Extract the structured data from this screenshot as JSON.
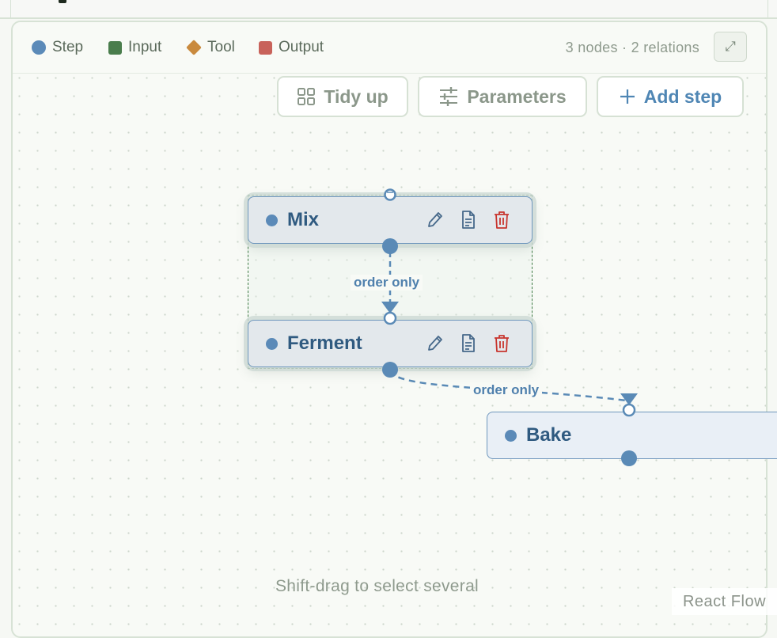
{
  "legend": {
    "items": [
      {
        "label": "Step",
        "color": "#5b8ab8",
        "shape": "circle"
      },
      {
        "label": "Input",
        "color": "#4a7d4c",
        "shape": "square"
      },
      {
        "label": "Tool",
        "color": "#c98a3e",
        "shape": "diamond"
      },
      {
        "label": "Output",
        "color": "#c8625a",
        "shape": "square"
      }
    ],
    "counts": "3 nodes · 2 relations",
    "expand_icon": "expand-icon"
  },
  "toolbar": {
    "tidy_label": "Tidy up",
    "parameters_label": "Parameters",
    "add_step_label": "Add step"
  },
  "nodes": {
    "mix": {
      "label": "Mix"
    },
    "ferment": {
      "label": "Ferment"
    },
    "bake": {
      "label": "Bake"
    }
  },
  "edges": [
    {
      "from": "Mix",
      "to": "Ferment",
      "label": "order only"
    },
    {
      "from": "Ferment",
      "to": "Bake",
      "label": "order only"
    }
  ],
  "hint": "Shift-drag to select several",
  "attribution": "React Flow",
  "colors": {
    "step": "#5b8ab8",
    "edge": "#5a8ab6",
    "delete": "#c8352e",
    "selection": "#3f7a45"
  }
}
